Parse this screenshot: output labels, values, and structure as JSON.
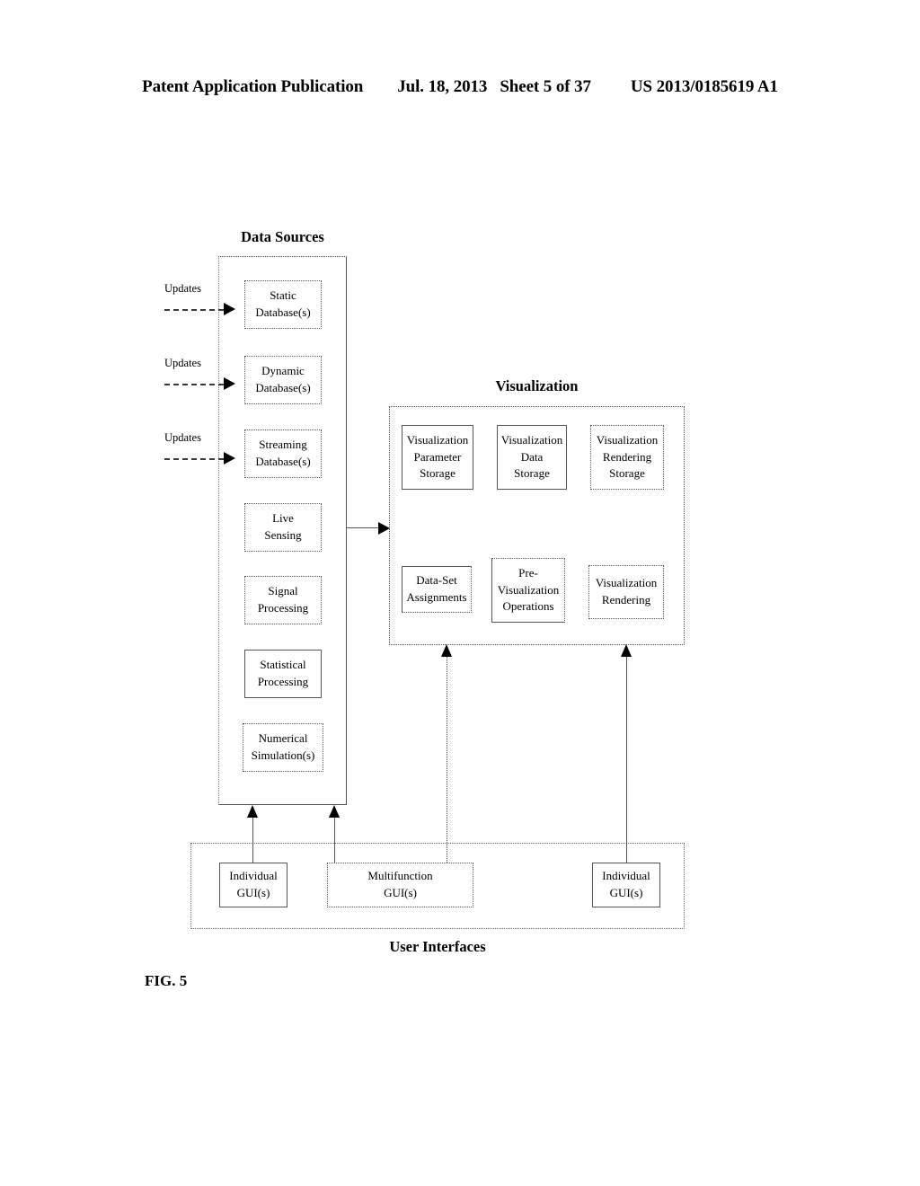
{
  "page_header": {
    "publication": "Patent Application Publication",
    "date": "Jul. 18, 2013",
    "sheet": "Sheet 5 of 37",
    "patent_number": "US 2013/0185619 A1"
  },
  "figure": {
    "label": "FIG. 5",
    "sections": {
      "data_sources": {
        "caption": "Data Sources",
        "nodes": [
          {
            "id": "static-database",
            "line1": "Static",
            "line2": "Database(s)"
          },
          {
            "id": "dynamic-database",
            "line1": "Dynamic",
            "line2": "Database(s)"
          },
          {
            "id": "streaming-database",
            "line1": "Streaming",
            "line2": "Database(s)"
          },
          {
            "id": "live-sensing",
            "line1": "Live",
            "line2": "Sensing"
          },
          {
            "id": "signal-processing",
            "line1": "Signal",
            "line2": "Processing"
          },
          {
            "id": "statistical-processing",
            "line1": "Statistical",
            "line2": "Processing"
          },
          {
            "id": "numerical-simulations",
            "line1": "Numerical",
            "line2": "Simulation(s)"
          }
        ]
      },
      "visualization": {
        "caption": "Visualization",
        "nodes": [
          {
            "id": "visualization-parameter-storage",
            "line1": "Visualization",
            "line2": "Parameter",
            "line3": "Storage"
          },
          {
            "id": "visualization-data-storage",
            "line1": "Visualization",
            "line2": "Data",
            "line3": "Storage"
          },
          {
            "id": "visualization-rendering-storage",
            "line1": "Visualization",
            "line2": "Rendering",
            "line3": "Storage"
          },
          {
            "id": "data-set-assignments",
            "line1": "Data-Set",
            "line2": "Assignments",
            "line3": ""
          },
          {
            "id": "pre-visualization-operations",
            "line1": "Pre-",
            "line2": "Visualization",
            "line3": "Operations"
          },
          {
            "id": "visualization-rendering",
            "line1": "Visualization",
            "line2": "Rendering",
            "line3": ""
          }
        ]
      },
      "user_interfaces": {
        "caption": "User Interfaces",
        "nodes": [
          {
            "id": "individual-gui-left",
            "line1": "Individual",
            "line2": "GUI(s)"
          },
          {
            "id": "multifunction-gui",
            "line1": "Multifunction",
            "line2": "GUI(s)"
          },
          {
            "id": "individual-gui-right",
            "line1": "Individual",
            "line2": "GUI(s)"
          }
        ]
      }
    },
    "update_labels": [
      {
        "id": "updates-static",
        "text": "Updates"
      },
      {
        "id": "updates-dynamic",
        "text": "Updates"
      },
      {
        "id": "updates-streaming",
        "text": "Updates"
      }
    ]
  }
}
